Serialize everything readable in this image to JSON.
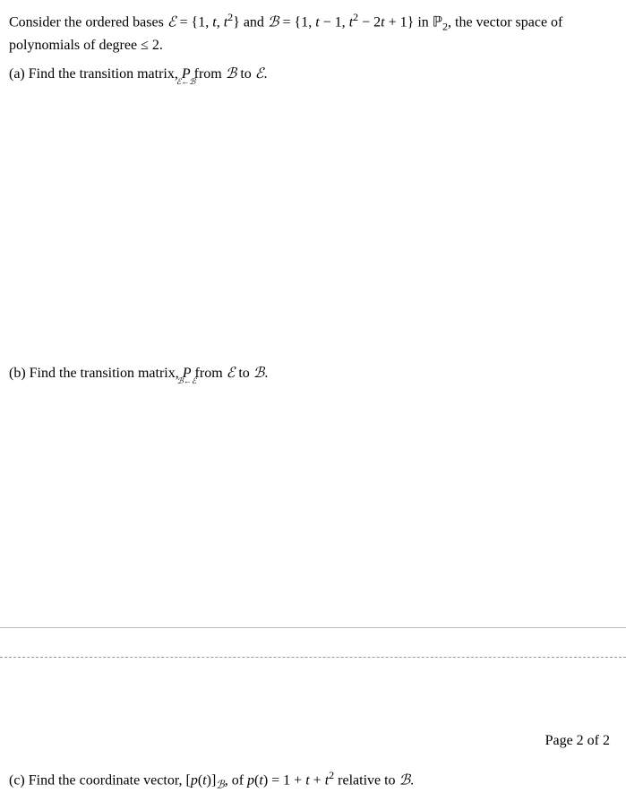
{
  "intro": {
    "prefix": "Consider the ordered bases ",
    "basisE_label": "ℰ",
    "eq1": " = {1, ",
    "t": "t",
    "comma": ", ",
    "t2": "t",
    "t2_sup": "2",
    "closeAnd": "} and ",
    "basisB_label": "ℬ",
    "eq2": " = {1, ",
    "tm1_a": "t",
    "tm1_b": " − 1, ",
    "t2b": "t",
    "t2b_sup": "2",
    "rest": " − 2",
    "t_rest": "t",
    "plus1": " + 1} in ",
    "P": "ℙ",
    "P_sub": "2",
    "tail": ", the vector space of polynomials of degree ≤ 2."
  },
  "partA": {
    "label": "(a) Find the transition matrix, ",
    "P": "P",
    "sub": "ℰ←ℬ",
    "mid": " from ",
    "from": "ℬ",
    "to_word": " to ",
    "to": "ℰ",
    "period": "."
  },
  "partB": {
    "label": "(b) Find the transition matrix, ",
    "P": "P",
    "sub": "ℬ←ℰ",
    "mid": " from ",
    "from": "ℰ",
    "to_word": " to ",
    "to": "ℬ",
    "period": "."
  },
  "pageNumber": "Page 2 of 2",
  "partC": {
    "label": "(c) Find the coordinate vector, [",
    "p": "p",
    "paren_t": "(",
    "t1": "t",
    "close_paren": ")]",
    "sub_B": "ℬ",
    "of": ", of ",
    "p2": "p",
    "paren_t2": "(",
    "t2": "t",
    "close_paren2": ") = 1 + ",
    "t3": "t",
    "plus": " + ",
    "t4": "t",
    "t4_sup": "2",
    "relative": " relative to ",
    "B": "ℬ",
    "period": "."
  }
}
